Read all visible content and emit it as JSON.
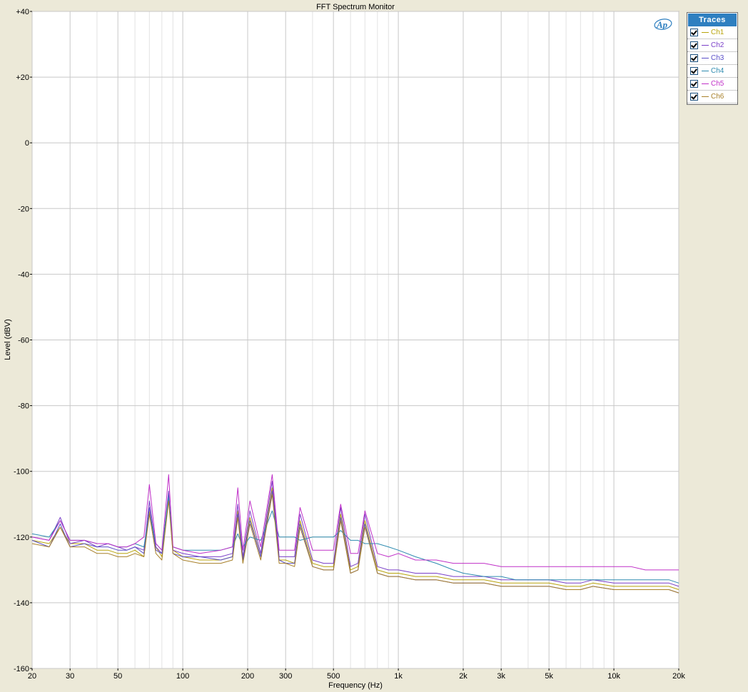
{
  "window": {
    "title": "FFT Spectrum Monitor",
    "background": "#ECE9D8"
  },
  "logo": {
    "text": "Ap",
    "color": "#2E7FC0"
  },
  "legend": {
    "header": "Traces",
    "header_color": "#2E7FC0",
    "items": [
      {
        "label": "Ch1",
        "color": "#B8A40C",
        "checked": true
      },
      {
        "label": "Ch2",
        "color": "#7A3FC8",
        "checked": true
      },
      {
        "label": "Ch3",
        "color": "#5A4FC8",
        "checked": true
      },
      {
        "label": "Ch4",
        "color": "#2E8BB0",
        "checked": true
      },
      {
        "label": "Ch5",
        "color": "#C030C8",
        "checked": true
      },
      {
        "label": "Ch6",
        "color": "#A8802A",
        "checked": true
      }
    ]
  },
  "chart_data": {
    "type": "line",
    "title": "FFT Spectrum Monitor",
    "xlabel": "Frequency (Hz)",
    "ylabel": "Level (dBV)",
    "xscale": "log",
    "xlim": [
      20,
      20000
    ],
    "ylim": [
      -160,
      40
    ],
    "grid": true,
    "legend_position": "right",
    "x_ticks": [
      {
        "value": 20,
        "label": "20"
      },
      {
        "value": 30,
        "label": "30"
      },
      {
        "value": 50,
        "label": "50"
      },
      {
        "value": 100,
        "label": "100"
      },
      {
        "value": 200,
        "label": "200"
      },
      {
        "value": 300,
        "label": "300"
      },
      {
        "value": 500,
        "label": "500"
      },
      {
        "value": 1000,
        "label": "1k"
      },
      {
        "value": 2000,
        "label": "2k"
      },
      {
        "value": 3000,
        "label": "3k"
      },
      {
        "value": 5000,
        "label": "5k"
      },
      {
        "value": 10000,
        "label": "10k"
      },
      {
        "value": 20000,
        "label": "20k"
      }
    ],
    "y_ticks": [
      {
        "value": 40,
        "label": "+40"
      },
      {
        "value": 20,
        "label": "+20"
      },
      {
        "value": 0,
        "label": "0"
      },
      {
        "value": -20,
        "label": "-20"
      },
      {
        "value": -40,
        "label": "-40"
      },
      {
        "value": -60,
        "label": "-60"
      },
      {
        "value": -80,
        "label": "-80"
      },
      {
        "value": -100,
        "label": "-100"
      },
      {
        "value": -120,
        "label": "-120"
      },
      {
        "value": -140,
        "label": "-140"
      },
      {
        "value": -160,
        "label": "-160"
      }
    ],
    "series": [
      {
        "name": "Ch1",
        "color": "#B8A40C",
        "x": [
          20,
          24,
          27,
          30,
          35,
          40,
          45,
          50,
          55,
          60,
          66,
          70,
          75,
          80,
          86,
          90,
          100,
          120,
          150,
          170,
          180,
          190,
          205,
          230,
          260,
          280,
          300,
          330,
          350,
          400,
          450,
          500,
          540,
          600,
          650,
          700,
          800,
          900,
          1000,
          1200,
          1500,
          1800,
          2000,
          2500,
          3000,
          3500,
          4000,
          5000,
          6000,
          7000,
          8000,
          10000,
          12000,
          14000,
          16000,
          18000,
          20000
        ],
        "y": [
          -121,
          -122,
          -117,
          -122,
          -122,
          -124,
          -124,
          -125,
          -125,
          -124,
          -126,
          -112,
          -123,
          -126,
          -108,
          -124,
          -126,
          -127,
          -127,
          -126,
          -112,
          -127,
          -114,
          -126,
          -105,
          -127,
          -127,
          -128,
          -115,
          -128,
          -129,
          -129,
          -113,
          -130,
          -129,
          -115,
          -130,
          -131,
          -131,
          -132,
          -132,
          -133,
          -133,
          -133,
          -134,
          -134,
          -134,
          -134,
          -135,
          -135,
          -134,
          -135,
          -135,
          -135,
          -135,
          -135,
          -136
        ]
      },
      {
        "name": "Ch2",
        "color": "#7A3FC8",
        "x": [
          20,
          24,
          27,
          30,
          35,
          40,
          45,
          50,
          55,
          60,
          66,
          70,
          75,
          80,
          86,
          90,
          100,
          120,
          150,
          170,
          180,
          190,
          205,
          230,
          260,
          280,
          300,
          330,
          350,
          400,
          450,
          500,
          540,
          600,
          650,
          700,
          800,
          900,
          1000,
          1200,
          1500,
          1800,
          2000,
          2500,
          3000,
          3500,
          4000,
          5000,
          6000,
          7000,
          8000,
          10000,
          12000,
          14000,
          16000,
          18000,
          20000
        ],
        "y": [
          -120,
          -121,
          -114,
          -122,
          -121,
          -123,
          -122,
          -123,
          -124,
          -123,
          -124,
          -109,
          -123,
          -125,
          -106,
          -124,
          -125,
          -126,
          -126,
          -125,
          -110,
          -126,
          -112,
          -125,
          -103,
          -126,
          -126,
          -126,
          -113,
          -127,
          -128,
          -128,
          -111,
          -129,
          -128,
          -113,
          -129,
          -130,
          -130,
          -131,
          -131,
          -132,
          -132,
          -132,
          -133,
          -133,
          -133,
          -133,
          -134,
          -134,
          -133,
          -134,
          -134,
          -134,
          -134,
          -134,
          -135
        ]
      },
      {
        "name": "Ch3",
        "color": "#5A4FC8",
        "x": [
          20,
          24,
          27,
          30,
          35,
          40,
          45,
          50,
          55,
          60,
          66,
          70,
          75,
          80,
          86,
          90,
          100,
          120,
          150,
          170,
          180,
          190,
          205,
          230,
          260,
          280,
          300,
          330,
          350,
          400,
          450,
          500,
          540,
          600,
          650,
          700,
          800,
          900,
          1000,
          1200,
          1500,
          1800,
          2000,
          2500,
          3000,
          3500,
          4000,
          5000,
          6000,
          7000,
          8000,
          10000,
          12000,
          14000,
          16000,
          18000,
          20000
        ],
        "y": [
          -121,
          -123,
          -116,
          -123,
          -122,
          -123,
          -123,
          -124,
          -124,
          -123,
          -125,
          -111,
          -124,
          -125,
          -107,
          -125,
          -126,
          -126,
          -127,
          -126,
          -113,
          -127,
          -115,
          -126,
          -106,
          -127,
          -128,
          -128,
          -116,
          -129,
          -130,
          -130,
          -114,
          -131,
          -130,
          -116,
          -131,
          -132,
          -132,
          -133,
          -133,
          -134,
          -134,
          -134,
          -135,
          -135,
          -135,
          -135,
          -136,
          -136,
          -135,
          -136,
          -136,
          -136,
          -136,
          -136,
          -137
        ]
      },
      {
        "name": "Ch4",
        "color": "#2E8BB0",
        "x": [
          20,
          24,
          27,
          30,
          35,
          40,
          45,
          50,
          55,
          60,
          66,
          70,
          75,
          80,
          86,
          90,
          100,
          120,
          150,
          170,
          180,
          190,
          205,
          230,
          260,
          280,
          300,
          330,
          350,
          400,
          450,
          500,
          540,
          600,
          650,
          700,
          800,
          900,
          1000,
          1200,
          1500,
          1800,
          2000,
          2500,
          3000,
          3500,
          4000,
          5000,
          6000,
          7000,
          8000,
          10000,
          12000,
          14000,
          16000,
          18000,
          20000
        ],
        "y": [
          -119,
          -120,
          -115,
          -121,
          -121,
          -122,
          -122,
          -123,
          -123,
          -122,
          -123,
          -113,
          -122,
          -124,
          -108,
          -123,
          -124,
          -124,
          -124,
          -123,
          -119,
          -123,
          -120,
          -121,
          -112,
          -120,
          -120,
          -120,
          -121,
          -120,
          -120,
          -120,
          -118,
          -121,
          -121,
          -122,
          -122,
          -123,
          -124,
          -126,
          -128,
          -130,
          -131,
          -132,
          -132,
          -133,
          -133,
          -133,
          -133,
          -133,
          -133,
          -133,
          -133,
          -133,
          -133,
          -133,
          -134
        ]
      },
      {
        "name": "Ch5",
        "color": "#C030C8",
        "x": [
          20,
          24,
          27,
          30,
          35,
          40,
          45,
          50,
          55,
          60,
          66,
          70,
          75,
          80,
          86,
          90,
          100,
          120,
          150,
          170,
          180,
          190,
          205,
          230,
          260,
          280,
          300,
          330,
          350,
          400,
          450,
          500,
          540,
          600,
          650,
          700,
          800,
          900,
          1000,
          1200,
          1500,
          1800,
          2000,
          2500,
          3000,
          3500,
          4000,
          5000,
          6000,
          7000,
          8000,
          10000,
          12000,
          14000,
          16000,
          18000,
          20000
        ],
        "y": [
          -120,
          -121,
          -115,
          -121,
          -121,
          -122,
          -122,
          -123,
          -123,
          -122,
          -120,
          -104,
          -122,
          -124,
          -101,
          -123,
          -124,
          -125,
          -124,
          -123,
          -105,
          -124,
          -109,
          -123,
          -101,
          -124,
          -124,
          -124,
          -111,
          -124,
          -124,
          -124,
          -110,
          -125,
          -125,
          -112,
          -125,
          -126,
          -125,
          -127,
          -127,
          -128,
          -128,
          -128,
          -129,
          -129,
          -129,
          -129,
          -129,
          -129,
          -129,
          -129,
          -129,
          -130,
          -130,
          -130,
          -130
        ]
      },
      {
        "name": "Ch6",
        "color": "#A8802A",
        "x": [
          20,
          24,
          27,
          30,
          35,
          40,
          45,
          50,
          55,
          60,
          66,
          70,
          75,
          80,
          86,
          90,
          100,
          120,
          150,
          170,
          180,
          190,
          205,
          230,
          260,
          280,
          300,
          330,
          350,
          400,
          450,
          500,
          540,
          600,
          650,
          700,
          800,
          900,
          1000,
          1200,
          1500,
          1800,
          2000,
          2500,
          3000,
          3500,
          4000,
          5000,
          6000,
          7000,
          8000,
          10000,
          12000,
          14000,
          16000,
          18000,
          20000
        ],
        "y": [
          -122,
          -123,
          -117,
          -123,
          -123,
          -125,
          -125,
          -126,
          -126,
          -125,
          -126,
          -113,
          -125,
          -127,
          -109,
          -125,
          -127,
          -128,
          -128,
          -127,
          -114,
          -128,
          -116,
          -127,
          -107,
          -128,
          -128,
          -129,
          -117,
          -129,
          -130,
          -130,
          -115,
          -131,
          -130,
          -117,
          -131,
          -132,
          -132,
          -133,
          -133,
          -134,
          -134,
          -134,
          -135,
          -135,
          -135,
          -135,
          -136,
          -136,
          -135,
          -136,
          -136,
          -136,
          -136,
          -136,
          -137
        ]
      }
    ]
  }
}
